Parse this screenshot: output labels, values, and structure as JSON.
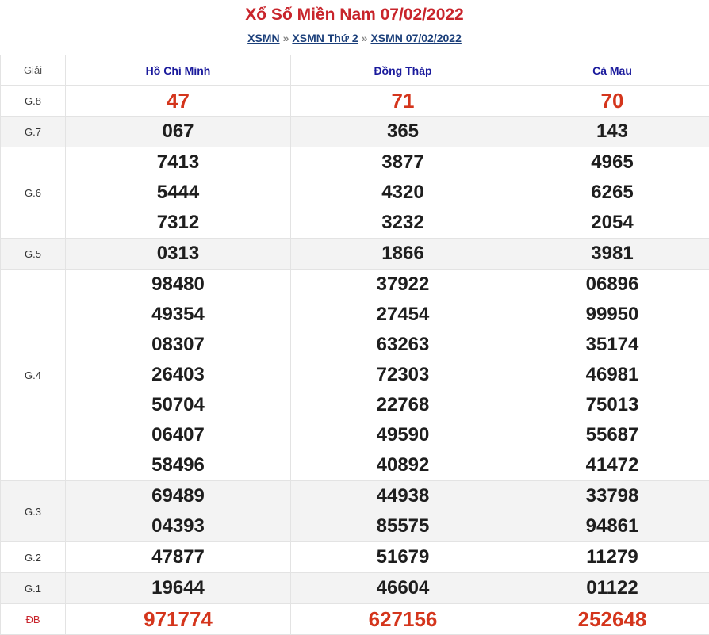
{
  "header": {
    "title": "Xổ Số Miền Nam 07/02/2022",
    "breadcrumb": [
      "XSMN",
      "XSMN Thứ 2",
      "XSMN 07/02/2022"
    ],
    "separator": "»"
  },
  "table": {
    "label_header": "Giải",
    "provinces": [
      "Hồ Chí Minh",
      "Đồng Tháp",
      "Cà Mau"
    ],
    "rows": [
      {
        "label": "G.8",
        "highlight": true,
        "alt": false,
        "values": [
          [
            "47"
          ],
          [
            "71"
          ],
          [
            "70"
          ]
        ]
      },
      {
        "label": "G.7",
        "highlight": false,
        "alt": true,
        "values": [
          [
            "067"
          ],
          [
            "365"
          ],
          [
            "143"
          ]
        ]
      },
      {
        "label": "G.6",
        "highlight": false,
        "alt": false,
        "values": [
          [
            "7413",
            "5444",
            "7312"
          ],
          [
            "3877",
            "4320",
            "3232"
          ],
          [
            "4965",
            "6265",
            "2054"
          ]
        ]
      },
      {
        "label": "G.5",
        "highlight": false,
        "alt": true,
        "values": [
          [
            "0313"
          ],
          [
            "1866"
          ],
          [
            "3981"
          ]
        ]
      },
      {
        "label": "G.4",
        "highlight": false,
        "alt": false,
        "values": [
          [
            "98480",
            "49354",
            "08307",
            "26403",
            "50704",
            "06407",
            "58496"
          ],
          [
            "37922",
            "27454",
            "63263",
            "72303",
            "22768",
            "49590",
            "40892"
          ],
          [
            "06896",
            "99950",
            "35174",
            "46981",
            "75013",
            "55687",
            "41472"
          ]
        ]
      },
      {
        "label": "G.3",
        "highlight": false,
        "alt": true,
        "values": [
          [
            "69489",
            "04393"
          ],
          [
            "44938",
            "85575"
          ],
          [
            "33798",
            "94861"
          ]
        ]
      },
      {
        "label": "G.2",
        "highlight": false,
        "alt": false,
        "values": [
          [
            "47877"
          ],
          [
            "51679"
          ],
          [
            "11279"
          ]
        ]
      },
      {
        "label": "G.1",
        "highlight": false,
        "alt": true,
        "values": [
          [
            "19644"
          ],
          [
            "46604"
          ],
          [
            "01122"
          ]
        ]
      },
      {
        "label": "ĐB",
        "highlight": true,
        "alt": false,
        "values": [
          [
            "971774"
          ],
          [
            "627156"
          ],
          [
            "252648"
          ]
        ]
      }
    ]
  },
  "colors": {
    "title": "#c8242b",
    "province_header": "#1a1a9c",
    "highlight_number": "#d4351c",
    "breadcrumb_link": "#1b3f7a",
    "alt_row": "#f3f3f3"
  }
}
